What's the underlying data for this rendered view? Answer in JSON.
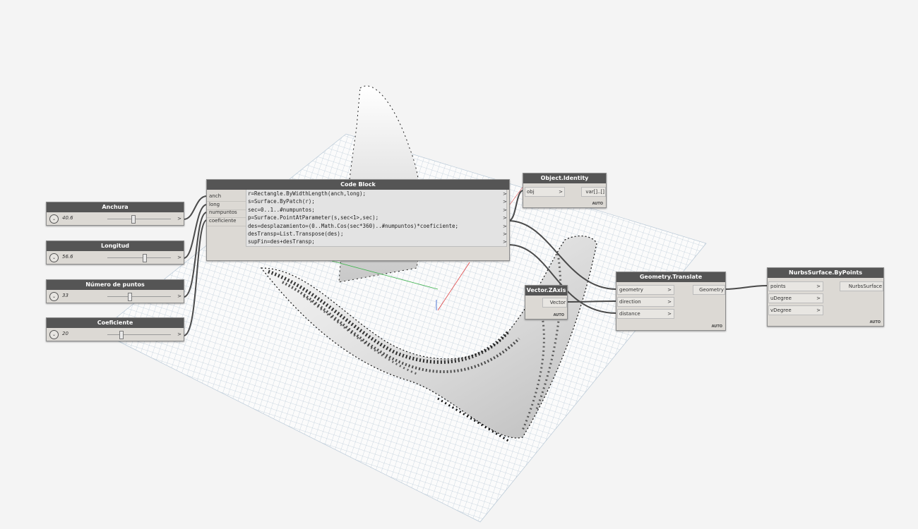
{
  "nodes": {
    "anchura": {
      "title": "Anchura",
      "value": "40.6",
      "level": 0.33
    },
    "longitud": {
      "title": "Longitud",
      "value": "56.6",
      "level": 0.47
    },
    "numero": {
      "title": "Número de puntos",
      "value": "33",
      "level": 0.26
    },
    "coeficiente": {
      "title": "Coeficiente",
      "value": "20",
      "level": 0.18
    },
    "code_block": {
      "title": "Code Block",
      "inputs": [
        "anch",
        "long",
        "numpuntos",
        "coeficiente"
      ],
      "lines": [
        "r=Rectangle.ByWidthLength(anch,long);",
        "s=Surface.ByPatch(r);",
        "sec=0..1..#numpuntos;",
        "p=Surface.PointAtParameter(s,sec<1>,sec);",
        "des=desplazamiento=(0..Math.Cos(sec*360)..#numpuntos)*coeficiente;",
        "desTransp=List.Transpose(des);",
        "supFin=des+desTransp;"
      ]
    },
    "object_identity": {
      "title": "Object.Identity",
      "input": "obj",
      "output": "var[]..[]",
      "auto": "AUTO"
    },
    "vector_zaxis": {
      "title": "Vector.ZAxis",
      "output": "Vector",
      "auto": "AUTO"
    },
    "geometry_translate": {
      "title": "Geometry.Translate",
      "inputs": [
        "geometry",
        "direction",
        "distance"
      ],
      "output": "Geometry",
      "auto": "AUTO"
    },
    "nurbs": {
      "title": "NurbsSurface.ByPoints",
      "inputs": [
        "points",
        "uDegree",
        "vDegree"
      ],
      "output": "NurbsSurface",
      "auto": "AUTO"
    }
  },
  "icons": {
    "slider_expand": "chevron-down-icon",
    "port_arrow": "chevron-right-icon"
  },
  "colors": {
    "node_header": "#555555",
    "node_body": "#dcd9d4",
    "wire": "#4a4a4a",
    "background": "#f4f4f4",
    "grid": "#9fb6c8"
  }
}
